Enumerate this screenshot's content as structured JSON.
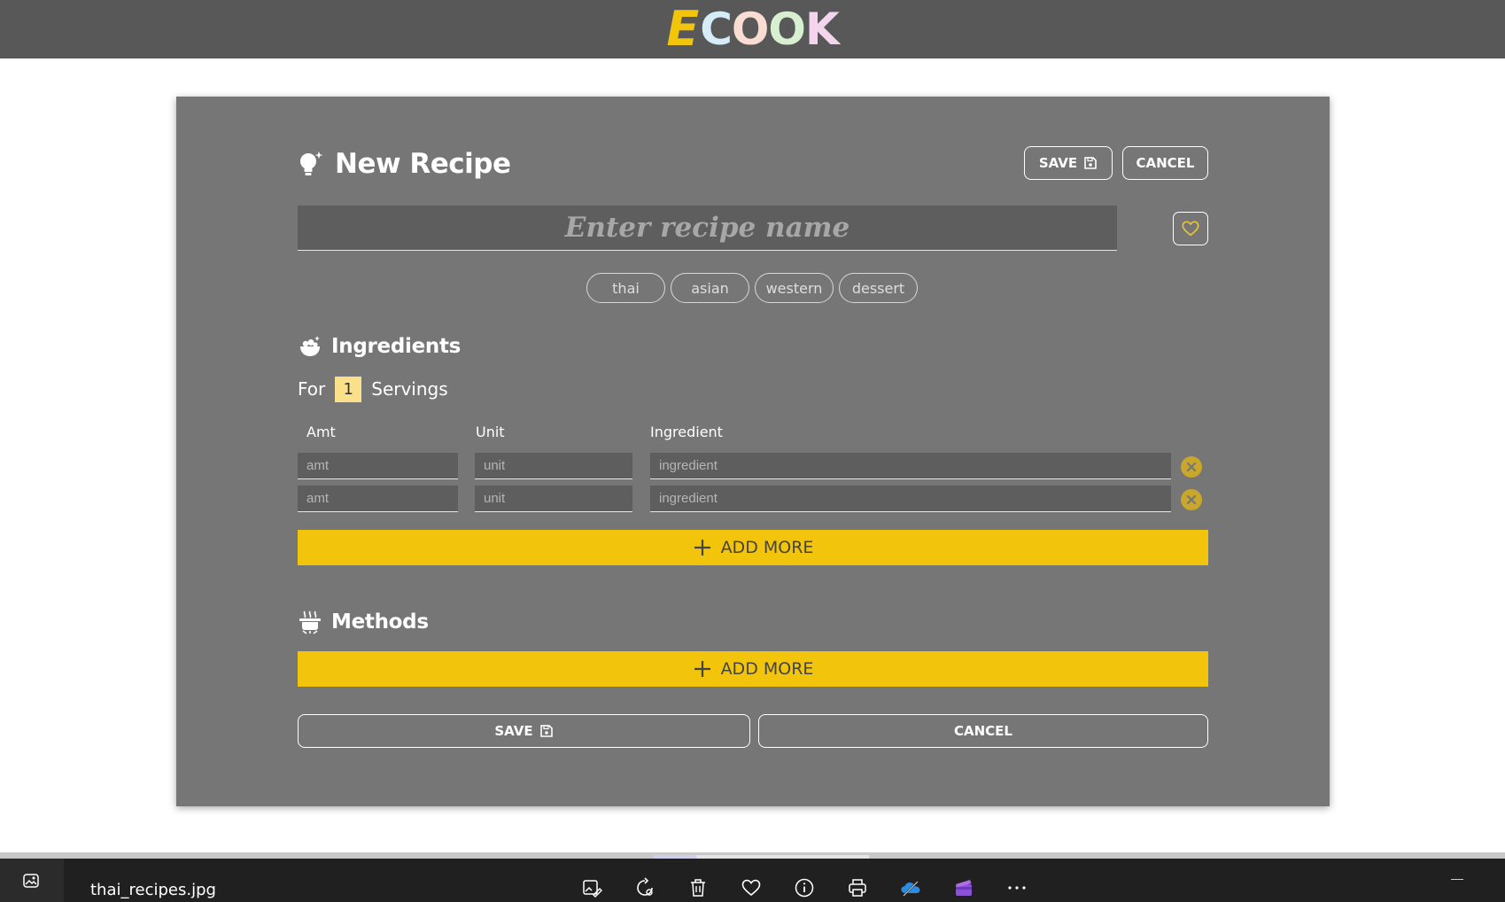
{
  "app": {
    "logo_letters": [
      "E",
      "C",
      "O",
      "O",
      "K"
    ],
    "logo_colors": [
      "#f2c40b",
      "#d6ecf8",
      "#f9dcd2",
      "#d8f0cf",
      "#f3d6ee"
    ]
  },
  "form": {
    "title": "New Recipe",
    "save_label": "SAVE",
    "cancel_label": "CANCEL",
    "name_placeholder": "Enter recipe name",
    "name_value": "",
    "tags": [
      "thai",
      "asian",
      "western",
      "dessert"
    ]
  },
  "ingredients": {
    "title": "Ingredients",
    "servings_prefix": "For",
    "servings_count": "1",
    "servings_suffix": "Servings",
    "columns": {
      "amt": "Amt",
      "unit": "Unit",
      "ingredient": "Ingredient"
    },
    "rows": [
      {
        "amt_placeholder": "amt",
        "unit_placeholder": "unit",
        "ingredient_placeholder": "ingredient"
      },
      {
        "amt_placeholder": "amt",
        "unit_placeholder": "unit",
        "ingredient_placeholder": "ingredient"
      }
    ],
    "add_label": "ADD MORE"
  },
  "methods": {
    "title": "Methods",
    "add_label": "ADD MORE"
  },
  "footer": {
    "save_label": "SAVE",
    "cancel_label": "CANCEL"
  },
  "viewer": {
    "filename": "thai_recipes.jpg",
    "tools": [
      "edit-image-icon",
      "rotate-icon",
      "delete-icon",
      "favorite-icon",
      "info-icon",
      "print-icon",
      "onedrive-icon",
      "clipchamp-icon",
      "more-icon"
    ]
  },
  "colors": {
    "header_bg": "#585858",
    "card_bg": "#767676",
    "accent_yellow": "#f2c40b",
    "servings_highlight": "#fae08a"
  }
}
